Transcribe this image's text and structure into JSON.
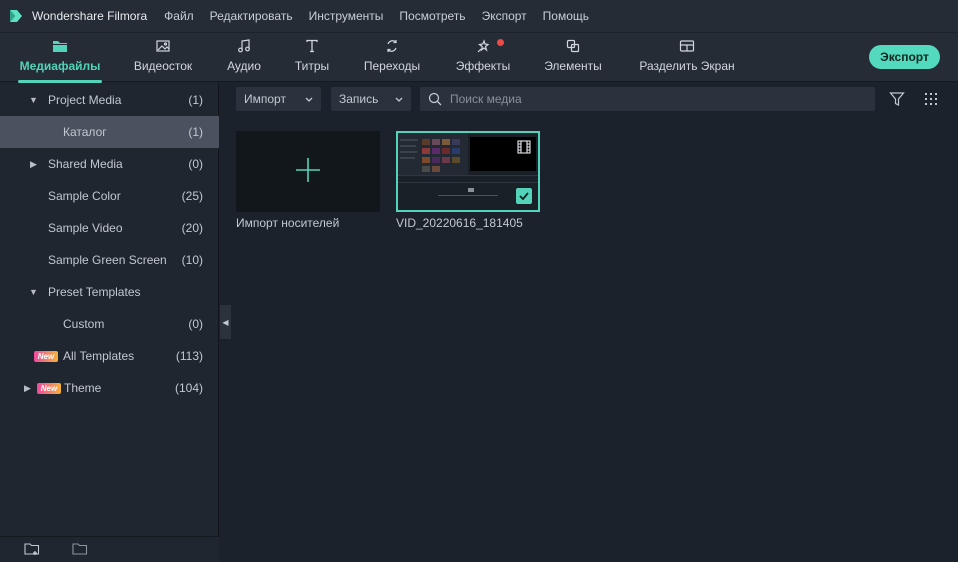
{
  "app": {
    "title": "Wondershare Filmora",
    "menu": [
      "Файл",
      "Редактировать",
      "Инструменты",
      "Посмотреть",
      "Экспорт",
      "Помощь"
    ]
  },
  "toolbar": {
    "tabs": [
      {
        "label": "Медиафайлы",
        "icon": "folder-icon"
      },
      {
        "label": "Видеосток",
        "icon": "stock-image-icon"
      },
      {
        "label": "Аудио",
        "icon": "music-note-icon"
      },
      {
        "label": "Титры",
        "icon": "text-icon"
      },
      {
        "label": "Переходы",
        "icon": "transition-icon"
      },
      {
        "label": "Эффекты",
        "icon": "effects-icon"
      },
      {
        "label": "Элементы",
        "icon": "elements-icon"
      },
      {
        "label": "Разделить Экран",
        "icon": "split-screen-icon"
      }
    ],
    "export_label": "Экспорт",
    "accent": "#53d3b9"
  },
  "sidebar": {
    "items": [
      {
        "label": "Project Media",
        "count": "(1)"
      },
      {
        "label": "Каталог",
        "count": "(1)"
      },
      {
        "label": "Shared Media",
        "count": "(0)"
      },
      {
        "label": "Sample Color",
        "count": "(25)"
      },
      {
        "label": "Sample Video",
        "count": "(20)"
      },
      {
        "label": "Sample Green Screen",
        "count": "(10)"
      },
      {
        "label": "Preset Templates",
        "count": ""
      },
      {
        "label": "Custom",
        "count": "(0)"
      },
      {
        "label": "All Templates",
        "count": "(113)",
        "badge": "New"
      },
      {
        "label": "Theme",
        "count": "(104)",
        "badge": "New"
      }
    ]
  },
  "filters": {
    "import_label": "Импорт",
    "record_label": "Запись",
    "search_placeholder": "Поиск медиа"
  },
  "media": {
    "import_card_label": "Импорт носителей",
    "clip_label": "VID_20220616_181405"
  }
}
